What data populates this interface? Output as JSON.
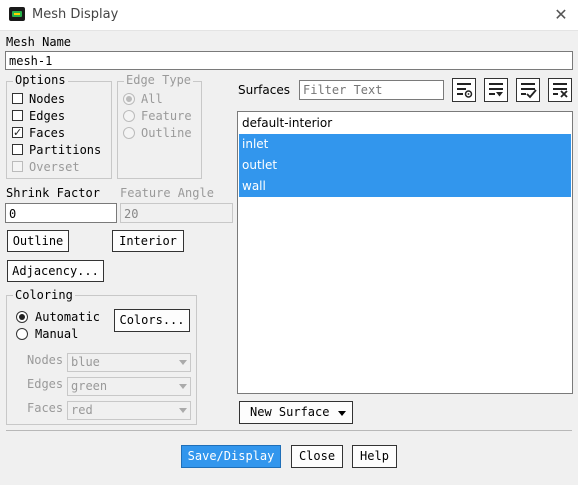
{
  "window": {
    "title": "Mesh Display",
    "close_glyph": "✕"
  },
  "mesh_name": {
    "label": "Mesh Name",
    "value": "mesh-1"
  },
  "options": {
    "title": "Options",
    "items": [
      {
        "label": "Nodes",
        "checked": false,
        "enabled": true
      },
      {
        "label": "Edges",
        "checked": false,
        "enabled": true
      },
      {
        "label": "Faces",
        "checked": true,
        "enabled": true
      },
      {
        "label": "Partitions",
        "checked": false,
        "enabled": true
      },
      {
        "label": "Overset",
        "checked": false,
        "enabled": false
      }
    ]
  },
  "edge_type": {
    "title": "Edge Type",
    "items": [
      {
        "label": "All",
        "selected": true
      },
      {
        "label": "Feature",
        "selected": false
      },
      {
        "label": "Outline",
        "selected": false
      }
    ]
  },
  "shrink_factor": {
    "label": "Shrink Factor",
    "value": "0"
  },
  "feature_angle": {
    "label": "Feature Angle",
    "value": "20"
  },
  "buttons": {
    "outline": "Outline",
    "interior": "Interior",
    "adjacency": "Adjacency...",
    "colors": "Colors...",
    "new_surface": "New Surface",
    "save_display": "Save/Display",
    "close": "Close",
    "help": "Help"
  },
  "coloring": {
    "title": "Coloring",
    "options": [
      {
        "label": "Automatic",
        "selected": true
      },
      {
        "label": "Manual",
        "selected": false
      }
    ],
    "nodes": {
      "label": "Nodes",
      "value": "blue"
    },
    "edges": {
      "label": "Edges",
      "value": "green"
    },
    "faces": {
      "label": "Faces",
      "value": "red"
    }
  },
  "surfaces": {
    "label": "Surfaces",
    "filter_placeholder": "Filter Text",
    "items": [
      {
        "name": "default-interior",
        "selected": false
      },
      {
        "name": "inlet",
        "selected": true
      },
      {
        "name": "outlet",
        "selected": true
      },
      {
        "name": "wall",
        "selected": true
      }
    ]
  },
  "colors": {
    "selection": "#3296ed",
    "primary_button": "#3296ed"
  }
}
